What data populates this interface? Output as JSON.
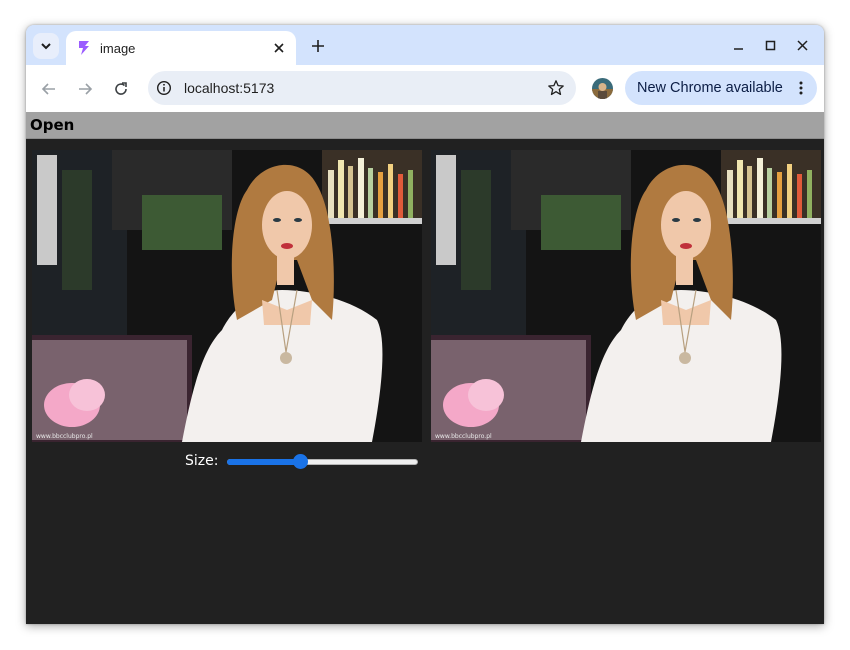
{
  "browser": {
    "tab": {
      "title": "image",
      "favicon": "vite-bolt-icon",
      "favicon_color": "#9b5cff"
    },
    "omnibox": {
      "url": "localhost:5173"
    },
    "update_chip": {
      "label": "New Chrome available"
    },
    "accent_color": "#1a73e8"
  },
  "app": {
    "menubar": {
      "open_label": "Open"
    },
    "images": [
      {
        "watermark": "www.bbcclubpro.pl",
        "name": "original-image"
      },
      {
        "watermark": "www.bbcclubpro.pl",
        "name": "processed-image"
      }
    ],
    "size_control": {
      "label": "Size:",
      "value_fraction": 0.38
    }
  }
}
